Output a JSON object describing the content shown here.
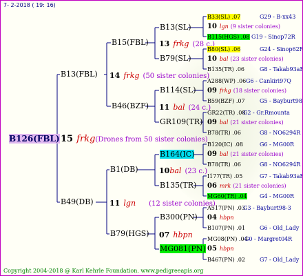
{
  "header": "7- 2-2018 ( 19: 16)",
  "footer": "Copyright 2004-2018 @ Karl Kehrle Foundation.   www.pedigreeapis.org",
  "colors": {
    "border": "#c000c0",
    "lines": "#000080",
    "yellow": "#ffff00",
    "green": "#00ee00",
    "cyan": "#00ddee",
    "red": "#cc0000",
    "purple": "#9900cc"
  },
  "root": {
    "name": "B126(FBL)",
    "num": "15",
    "mark": "frkg",
    "note": "(Drones from 50 sister colonies)"
  },
  "gen2": {
    "top": {
      "name": "B13(FBL)",
      "num": "14",
      "mark": "frkg",
      "note": "(50 sister colonies)"
    },
    "bottom": {
      "name": "B49(DB)",
      "num": "11",
      "mark": "lgn",
      "note": "(12 sister colonies)"
    }
  },
  "gen3": {
    "a": {
      "name": "B15(FBL)",
      "num": "13",
      "mark": "frkg",
      "note": "(28 c.)"
    },
    "b": {
      "name": "B46(BZF)",
      "num": "11",
      "mark": "bal",
      "note": "(24 c.)"
    },
    "c": {
      "name": "B1(DB)",
      "num": "10",
      "mark": "bal",
      "note": "(23 c.)"
    },
    "d": {
      "name": "B79(HGS)",
      "num": "07",
      "mark": "hbpn",
      "note": ""
    }
  },
  "gen4": {
    "a1": "B13(SL)",
    "a2": "B79(SL)",
    "b1": "B114(SL)",
    "b2": "GR109(TR)",
    "c1": "B164(IC)",
    "c2": "B135(TR)",
    "d1": "B300(PN)",
    "d2": "MG081(PN)"
  },
  "gen5": [
    {
      "name": "B33(SL) .07",
      "code": "G29 - B-xx43"
    },
    {
      "num": "10",
      "mark": "lgn",
      "note": "(9 sister colonies)"
    },
    {
      "name": "B115(HGS) .08",
      "code": "G19 - Sinop72R"
    },
    {
      "name": "B80(SL) .06",
      "code": "G24 - Sinop62R"
    },
    {
      "num": "10",
      "mark": "bal",
      "note": "(23 sister colonies)"
    },
    {
      "name": "B135(TR) .06",
      "code": "G8 - Takab93aR"
    },
    {
      "name": "A288(WP) .06",
      "code": "G6 - Cankiri97Q"
    },
    {
      "num": "09",
      "mark": "frkg",
      "note": "(18 sister colonies)"
    },
    {
      "name": "B59(BZF) .07",
      "code": "G5 - Bayburt98-3"
    },
    {
      "name": "GR22(TR) .08",
      "code": "G2 - Gr.Rmounta"
    },
    {
      "num": "09",
      "mark": "bal",
      "note": "(21 sister colonies)"
    },
    {
      "name": "B78(TR) .06",
      "code": "G8 - NO6294R"
    },
    {
      "name": "B120(IC) .08",
      "code": "G6 - MG00R"
    },
    {
      "num": "09",
      "mark": "bal",
      "note": "(21 sister colonies)"
    },
    {
      "name": "B78(TR) .06",
      "code": "G8 - NO6294R"
    },
    {
      "name": "I177(TR) .05",
      "code": "G7 - Takab93aR"
    },
    {
      "num": "06",
      "mark": "mrk",
      "note": "(21 sister colonies)"
    },
    {
      "name": "MG60(TR) .04",
      "code": "G4 - MG00R"
    },
    {
      "name": "A517(PN) .03",
      "code": "G3 - Bayburt98-3"
    },
    {
      "num": "04",
      "mark": "hbpn",
      "note": ""
    },
    {
      "name": "B107(PN) .01",
      "code": "G6 - Old_Lady"
    },
    {
      "name": "MG08(PN) .04",
      "code": "G0 - Margret04R"
    },
    {
      "num": "05",
      "mark": "hbpn",
      "note": ""
    },
    {
      "name": "B467(PN) .02",
      "code": "G7 - Old_Lady"
    }
  ]
}
